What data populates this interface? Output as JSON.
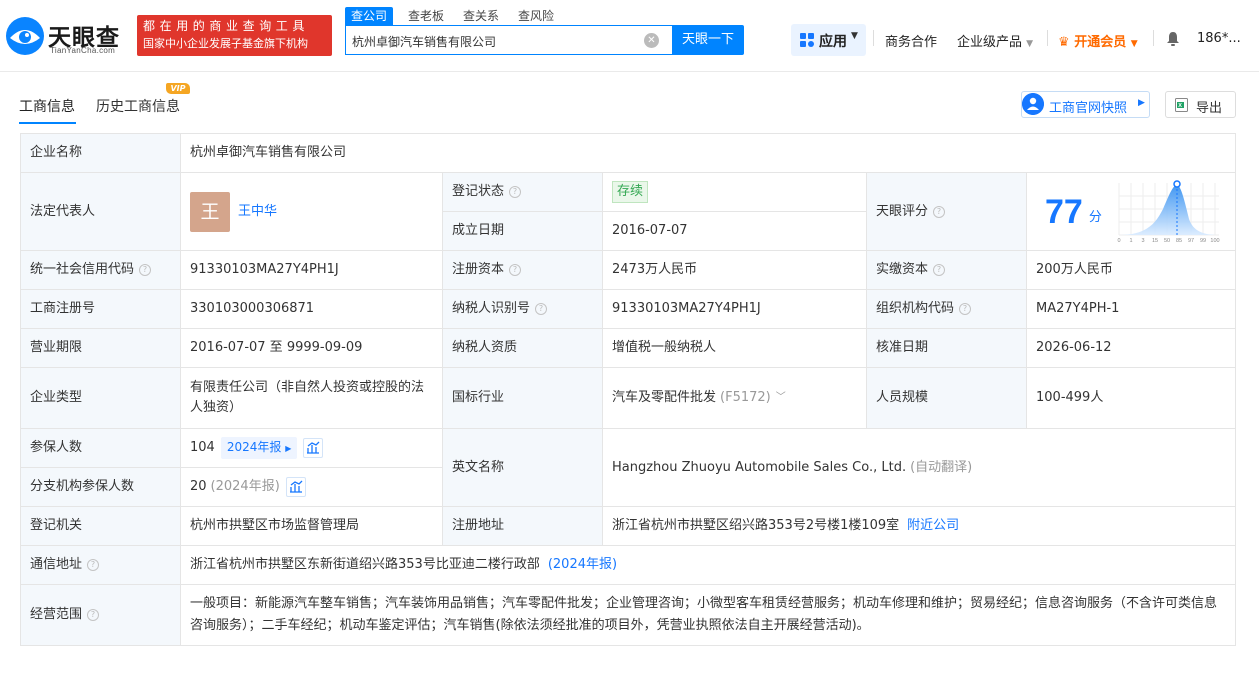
{
  "header": {
    "logo_name": "天眼查",
    "logo_sub": "TianYanCha.com",
    "slogan_line1": "都在用的商业查询工具",
    "slogan_line2": "国家中小企业发展子基金旗下机构",
    "search_tabs": [
      "查公司",
      "查老板",
      "查关系",
      "查风险"
    ],
    "search_value": "杭州卓御汽车销售有限公司",
    "search_button": "天眼一下",
    "nav": {
      "apps": "应用",
      "business": "商务合作",
      "enterprise": "企业级产品",
      "vip": "开通会员",
      "user": "186*..."
    }
  },
  "tabs": {
    "active": "工商信息",
    "history": "历史工商信息",
    "vip_badge": "VIP"
  },
  "actions": {
    "snapshot": "工商官网快照",
    "export": "导出"
  },
  "company": {
    "name_label": "企业名称",
    "name": "杭州卓御汽车销售有限公司",
    "legal_rep_label": "法定代表人",
    "legal_rep_avatar": "王",
    "legal_rep": "王中华",
    "reg_status_label": "登记状态",
    "reg_status": "存续",
    "founded_label": "成立日期",
    "founded": "2016-07-07",
    "score_label": "天眼评分",
    "score": "77",
    "score_unit": "分",
    "score_axis": [
      "0",
      "1",
      "3",
      "15",
      "50",
      "85",
      "97",
      "99",
      "100"
    ],
    "credit_code_label": "统一社会信用代码",
    "credit_code": "91330103MA27Y4PH1J",
    "reg_capital_label": "注册资本",
    "reg_capital": "2473万人民币",
    "paid_capital_label": "实缴资本",
    "paid_capital": "200万人民币",
    "reg_no_label": "工商注册号",
    "reg_no": "330103000306871",
    "taxpayer_id_label": "纳税人识别号",
    "taxpayer_id": "91330103MA27Y4PH1J",
    "org_code_label": "组织机构代码",
    "org_code": "MA27Y4PH-1",
    "term_label": "营业期限",
    "term": "2016-07-07 至 9999-09-09",
    "taxpayer_qual_label": "纳税人资质",
    "taxpayer_qual": "增值税一般纳税人",
    "approve_date_label": "核准日期",
    "approve_date": "2026-06-12",
    "type_label": "企业类型",
    "type": "有限责任公司（非自然人投资或控股的法人独资）",
    "industry_label": "国标行业",
    "industry": "汽车及零配件批发",
    "industry_code": "(F5172)",
    "staff_label": "人员规模",
    "staff": "100-499人",
    "insured_label": "参保人数",
    "insured": "104",
    "insured_report": "2024年报",
    "branch_insured_label": "分支机构参保人数",
    "branch_insured": "20",
    "branch_insured_report": "(2024年报)",
    "english_name_label": "英文名称",
    "english_name": "Hangzhou Zhuoyu Automobile Sales Co., Ltd.",
    "english_name_note": "(自动翻译)",
    "authority_label": "登记机关",
    "authority": "杭州市拱墅区市场监督管理局",
    "reg_address_label": "注册地址",
    "reg_address": "浙江省杭州市拱墅区绍兴路353号2号楼1楼109室",
    "nearby": "附近公司",
    "mail_address_label": "通信地址",
    "mail_address": "浙江省杭州市拱墅区东新街道绍兴路353号比亚迪二楼行政部",
    "mail_address_report": "(2024年报)",
    "scope_label": "经营范围",
    "scope": "一般项目：新能源汽车整车销售；汽车装饰用品销售；汽车零配件批发；企业管理咨询；小微型客车租赁经营服务；机动车修理和维护；贸易经纪；信息咨询服务（不含许可类信息咨询服务）；二手车经纪；机动车鉴定评估；汽车销售(除依法须经批准的项目外，凭营业执照依法自主开展经营活动)。"
  }
}
